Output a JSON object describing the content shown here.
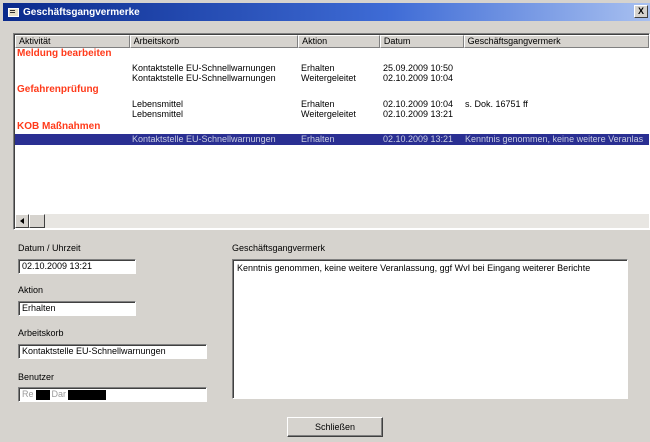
{
  "window": {
    "title": "Geschäftsgangvermerke",
    "close_label": "X"
  },
  "list": {
    "columns": [
      "Aktivität",
      "Arbeitskorb",
      "Aktion",
      "Datum",
      "Geschäftsgangvermerk"
    ],
    "groups": [
      {
        "name": "Meldung bearbeiten",
        "rows": [
          {
            "arbeitskorb": "Kontaktstelle EU-Schnellwarnungen",
            "aktion": "Erhalten",
            "datum": "25.09.2009 10:50",
            "vermerk": ""
          },
          {
            "arbeitskorb": "Kontaktstelle EU-Schnellwarnungen",
            "aktion": "Weitergeleitet",
            "datum": "02.10.2009 10:04",
            "vermerk": ""
          }
        ]
      },
      {
        "name": "Gefahrenprüfung",
        "rows": [
          {
            "arbeitskorb": "Lebensmittel",
            "aktion": "Erhalten",
            "datum": "02.10.2009 10:04",
            "vermerk": "s. Dok. 16751 ff"
          },
          {
            "arbeitskorb": "Lebensmittel",
            "aktion": "Weitergeleitet",
            "datum": "02.10.2009 13:21",
            "vermerk": ""
          }
        ]
      },
      {
        "name": "KOB Maßnahmen",
        "rows": [
          {
            "arbeitskorb": "Kontaktstelle EU-Schnellwarnungen",
            "aktion": "Erhalten",
            "datum": "02.10.2009 13:21",
            "vermerk": "Kenntnis genommen, keine weitere Veranlas",
            "selected": true
          }
        ]
      }
    ]
  },
  "details": {
    "datum_label": "Datum / Uhrzeit",
    "datum_value": "02.10.2009 13:21",
    "aktion_label": "Aktion",
    "aktion_value": "Erhalten",
    "arbeitskorb_label": "Arbeitskorb",
    "arbeitskorb_value": "Kontaktstelle EU-Schnellwarnungen",
    "benutzer_label": "Benutzer",
    "benutzer_value_part1": "Re",
    "benutzer_value_part2": "Dar",
    "vermerk_label": "Geschäftsgangvermerk",
    "vermerk_value": "Kenntnis genommen, keine weitere Veranlassung, ggf WvI bei Eingang weiterer Berichte"
  },
  "buttons": {
    "close_label": "Schließen"
  }
}
